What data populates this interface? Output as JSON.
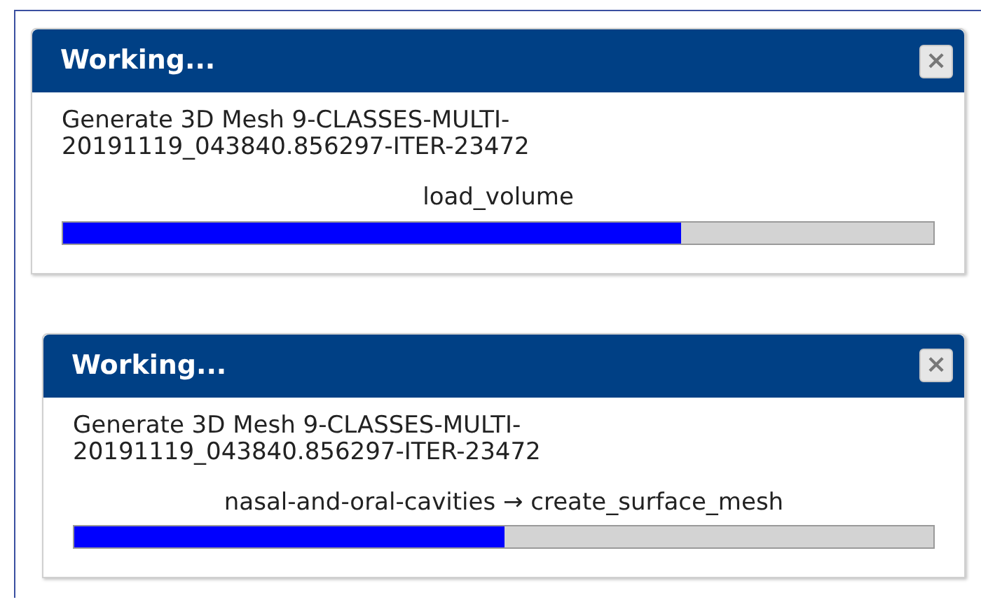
{
  "dialogs": [
    {
      "title": "Working...",
      "close": "×",
      "message": "Generate 3D Mesh 9-CLASSES-MULTI-20191119_043840.856297-ITER-23472",
      "step": "load_volume",
      "level": 0.71
    },
    {
      "title": "Working...",
      "close": "×",
      "message": "Generate 3D Mesh 9-CLASSES-MULTI-20191119_043840.856297-ITER-23472",
      "step": "nasal-and-oral-cavities → create_surface_mesh",
      "level": 0.5
    }
  ]
}
